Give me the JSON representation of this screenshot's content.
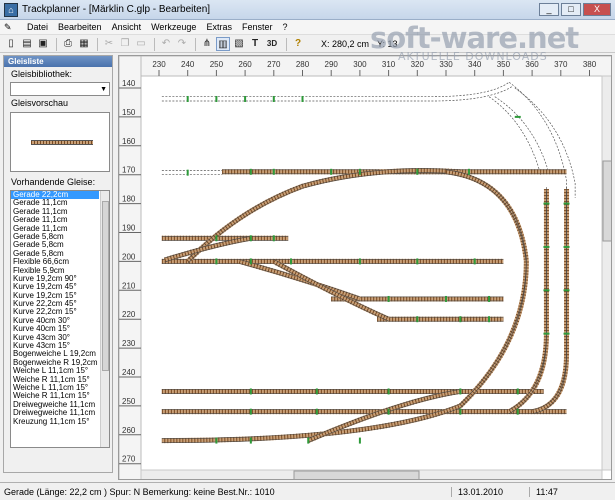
{
  "window": {
    "title": "Trackplanner - [Märklin C.glp - Bearbeiten]",
    "buttons": [
      "_",
      "□",
      "X"
    ]
  },
  "menu": [
    "Datei",
    "Bearbeiten",
    "Ansicht",
    "Werkzeuge",
    "Extras",
    "Fenster",
    "?"
  ],
  "toolbar": {
    "coord_x": "X: 280,2 cm",
    "coord_y": "Y: 13"
  },
  "left_panel": {
    "header": "Gleisliste",
    "library_label": "Gleisbibliothek:",
    "preview_label": "Gleisvorschau",
    "list_label": "Vorhandende Gleise:",
    "items": [
      "Gerade 22,2cm",
      "Gerade 11,1cm",
      "Gerade 11,1cm",
      "Gerade 11,1cm",
      "Gerade 11,1cm",
      "Gerade 5,8cm",
      "Gerade 5,8cm",
      "Gerade 5,8cm",
      "Flexible 66,6cm",
      "Flexible 5,9cm",
      "Kurve 19,2cm 90°",
      "Kurve 19,2cm 45°",
      "Kurve 19,2cm 15°",
      "Kurve 22,2cm 45°",
      "Kurve 22,2cm 15°",
      "Kurve 40cm 30°",
      "Kurve 40cm 15°",
      "Kurve 43cm 30°",
      "Kurve 43cm 15°",
      "Bogenweiche L 19,2cm",
      "Bogenweiche R 19,2cm",
      "Weiche L 11,1cm 15°",
      "Weiche R 11,1cm 15°",
      "Weiche L 11,1cm 15°",
      "Weiche R 11,1cm 15°",
      "Dreiwegweiche 11,1cm",
      "Dreiwegweiche 11,1cm",
      "Kreuzung 11,1cm 15°"
    ]
  },
  "canvas": {
    "x_ticks": [
      "230",
      "240",
      "250",
      "260",
      "270",
      "280",
      "290",
      "300",
      "310",
      "320",
      "330",
      "340",
      "350",
      "360",
      "370",
      "380"
    ],
    "y_ticks": [
      "140",
      "150",
      "160",
      "170",
      "180",
      "190",
      "200",
      "210",
      "220",
      "230",
      "240",
      "250",
      "260",
      "270"
    ]
  },
  "status": {
    "info": "Gerade (Länge: 22,2 cm ) Spur: N Bemerkung: keine  Best.Nr.: 1010",
    "date": "13.01.2010",
    "time": "11:47"
  },
  "watermark": {
    "brand": "soft-ware.net",
    "tagline": "AKTUELLE DOWNLOADS"
  },
  "colors": {
    "tie": "#7a4a21",
    "rail": "#444444",
    "ballast": "#c8a078",
    "switch_mark": "#2e9a3a",
    "selection": "#3399ff"
  }
}
